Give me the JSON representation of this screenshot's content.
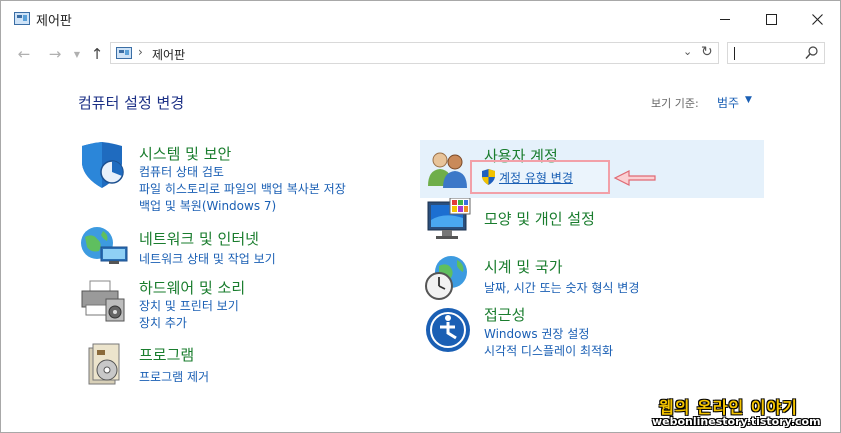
{
  "window": {
    "title": "제어판"
  },
  "address": {
    "path": "제어판",
    "separator": "›"
  },
  "content": {
    "heading": "컴퓨터 설정 변경",
    "view_by_label": "보기 기준:",
    "view_by_value": "범주"
  },
  "categories": [
    {
      "title": "시스템 및 보안",
      "icon": "shield-icon",
      "links": [
        "컴퓨터 상태 검토",
        "파일 히스토리로 파일의 백업 복사본 저장",
        "백업 및 복원(Windows 7)"
      ]
    },
    {
      "title": "네트워크 및 인터넷",
      "icon": "network-icon",
      "links": [
        "네트워크 상태 및 작업 보기"
      ]
    },
    {
      "title": "하드웨어 및 소리",
      "icon": "printer-icon",
      "links": [
        "장치 및 프린터 보기",
        "장치 추가"
      ]
    },
    {
      "title": "프로그램",
      "icon": "programs-icon",
      "links": [
        "프로그램 제거"
      ]
    },
    {
      "title": "사용자 계정",
      "icon": "users-icon",
      "links": [
        "계정 유형 변경"
      ]
    },
    {
      "title": "모양 및 개인 설정",
      "icon": "monitor-icon",
      "links": []
    },
    {
      "title": "시계 및 국가",
      "icon": "clock-globe-icon",
      "links": [
        "날짜, 시간 또는 숫자 형식 변경"
      ]
    },
    {
      "title": "접근성",
      "icon": "accessibility-icon",
      "links": [
        "Windows 권장 설정",
        "시각적 디스플레이 최적화"
      ]
    }
  ],
  "watermark": {
    "title": "웹의 온라인 이야기",
    "url": "webonlinestory.tistory.com"
  },
  "colors": {
    "category_title": "#1a7d2e",
    "link": "#1a5fb4",
    "heading": "#1e3287",
    "highlight_border": "#f2a0a8",
    "hover_bg": "#e5f1fb"
  }
}
